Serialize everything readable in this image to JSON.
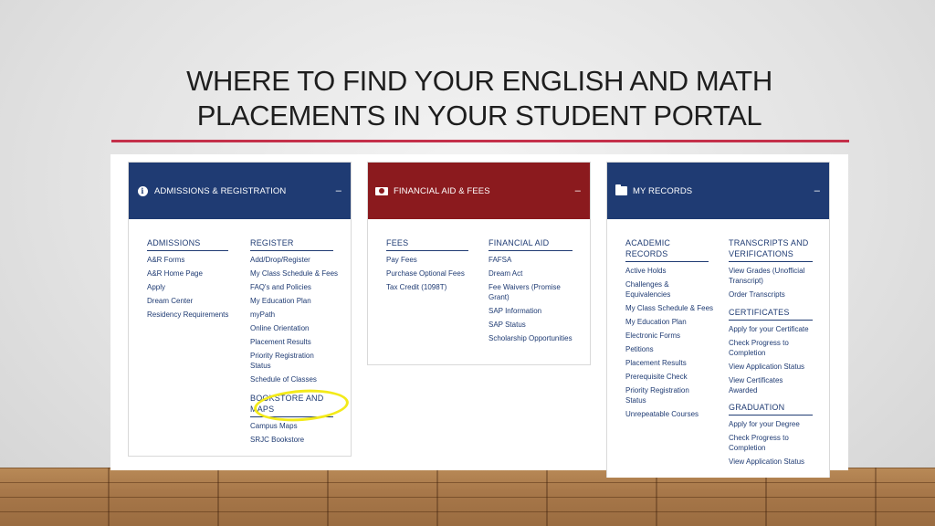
{
  "slide": {
    "title_line1": "WHERE TO FIND YOUR ENGLISH AND MATH",
    "title_line2": "PLACEMENTS IN YOUR STUDENT PORTAL"
  },
  "colors": {
    "navy": "#1f3b73",
    "maroon": "#8b1a1e",
    "rule": "#c4304a",
    "highlight": "#f3ea1a"
  },
  "cards": {
    "admissions": {
      "header": "ADMISSIONS & REGISTRATION",
      "icon": "info-icon",
      "collapse": "–",
      "admissions": {
        "title": "ADMISSIONS",
        "links": [
          "A&R Forms",
          "A&R Home Page",
          "Apply",
          "Dream Center",
          "Residency Requirements"
        ]
      },
      "register": {
        "title": "REGISTER",
        "links": [
          "Add/Drop/Register",
          "My Class Schedule & Fees",
          "FAQ's and Policies",
          "My Education Plan",
          "myPath",
          "Online Orientation",
          "Placement Results",
          "Priority Registration Status",
          "Schedule of Classes"
        ]
      },
      "bookstore": {
        "title": "BOOKSTORE AND MAPS",
        "links": [
          "Campus Maps",
          "SRJC Bookstore"
        ]
      }
    },
    "financial": {
      "header": "FINANCIAL AID & FEES",
      "icon": "money-icon",
      "collapse": "–",
      "fees": {
        "title": "FEES",
        "links": [
          "Pay Fees",
          "Purchase Optional Fees",
          "Tax Credit (1098T)"
        ]
      },
      "aid": {
        "title": "FINANCIAL AID",
        "links": [
          "FAFSA",
          "Dream Act",
          "Fee Waivers (Promise Grant)",
          "SAP Information",
          "SAP Status",
          "Scholarship Opportunities"
        ]
      }
    },
    "records": {
      "header": "MY RECORDS",
      "icon": "folder-icon",
      "collapse": "–",
      "academic": {
        "title": "ACADEMIC RECORDS",
        "links": [
          "Active Holds",
          "Challenges & Equivalencies",
          "My Class Schedule & Fees",
          "My Education Plan",
          "Electronic Forms",
          "Petitions",
          "Placement Results",
          "Prerequisite Check",
          "Priority Registration Status",
          "Unrepeatable Courses"
        ]
      },
      "transcripts": {
        "title": "TRANSCRIPTS AND VERIFICATIONS",
        "links": [
          "View Grades (Unofficial Transcript)",
          "Order Transcripts"
        ]
      },
      "certificates": {
        "title": "CERTIFICATES",
        "links": [
          "Apply for your Certificate",
          "Check Progress to Completion",
          "View Application Status",
          "View Certificates Awarded"
        ]
      },
      "graduation": {
        "title": "GRADUATION",
        "links": [
          "Apply for your Degree",
          "Check Progress to Completion",
          "View Application Status"
        ]
      }
    }
  }
}
